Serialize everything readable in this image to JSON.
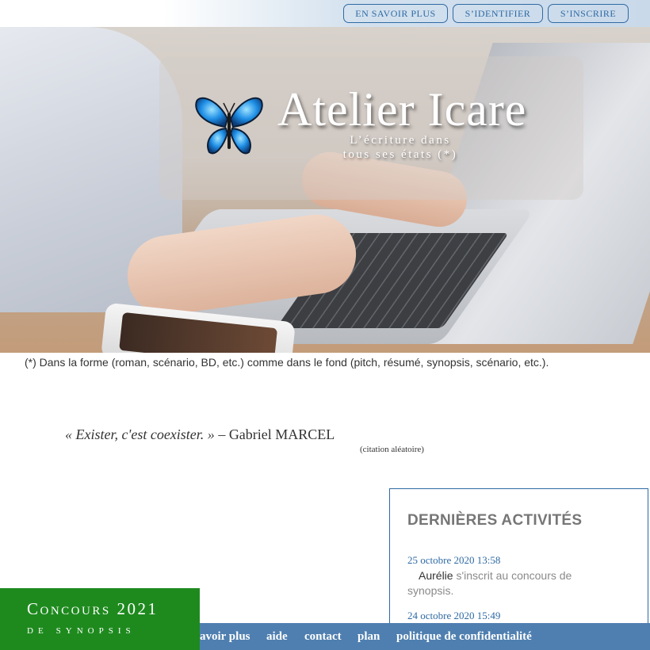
{
  "topnav": {
    "savoir_plus": "EN SAVOIR PLUS",
    "identifier": "S’IDENTIFIER",
    "inscrire": "S’INSCRIRE"
  },
  "hero": {
    "brand": "Atelier Icare",
    "tagline_line1": "L’écriture dans",
    "tagline_line2": "tous ses états (*)",
    "logo_icon": "butterfly-icon"
  },
  "footnote": "(*) Dans la forme (roman, scénario, BD, etc.) comme dans le fond (pitch, résumé, synopsis, scénario, etc.).",
  "quote": {
    "text": "« Exister, c'est coexister. »",
    "author": "– Gabriel MARCEL",
    "source": "(citation aléatoire)"
  },
  "activities": {
    "title": "DERNIÈRES ACTIVITÉS",
    "items": [
      {
        "date": "25 octobre 2020 13:58",
        "user": "Aurélie",
        "action": " s'inscrit au concours de synopsis."
      },
      {
        "date": "24 octobre 2020 15:49"
      }
    ]
  },
  "footer": {
    "links": [
      "avoir plus",
      "aide",
      "contact",
      "plan",
      "politique de confidentialité"
    ]
  },
  "concours": {
    "line1": "Concours 2021",
    "line2": "de synopsis"
  },
  "colors": {
    "accent": "#2f6aa4",
    "footer_bg": "#4f7fb0",
    "concours_bg": "#1e8a1e"
  }
}
